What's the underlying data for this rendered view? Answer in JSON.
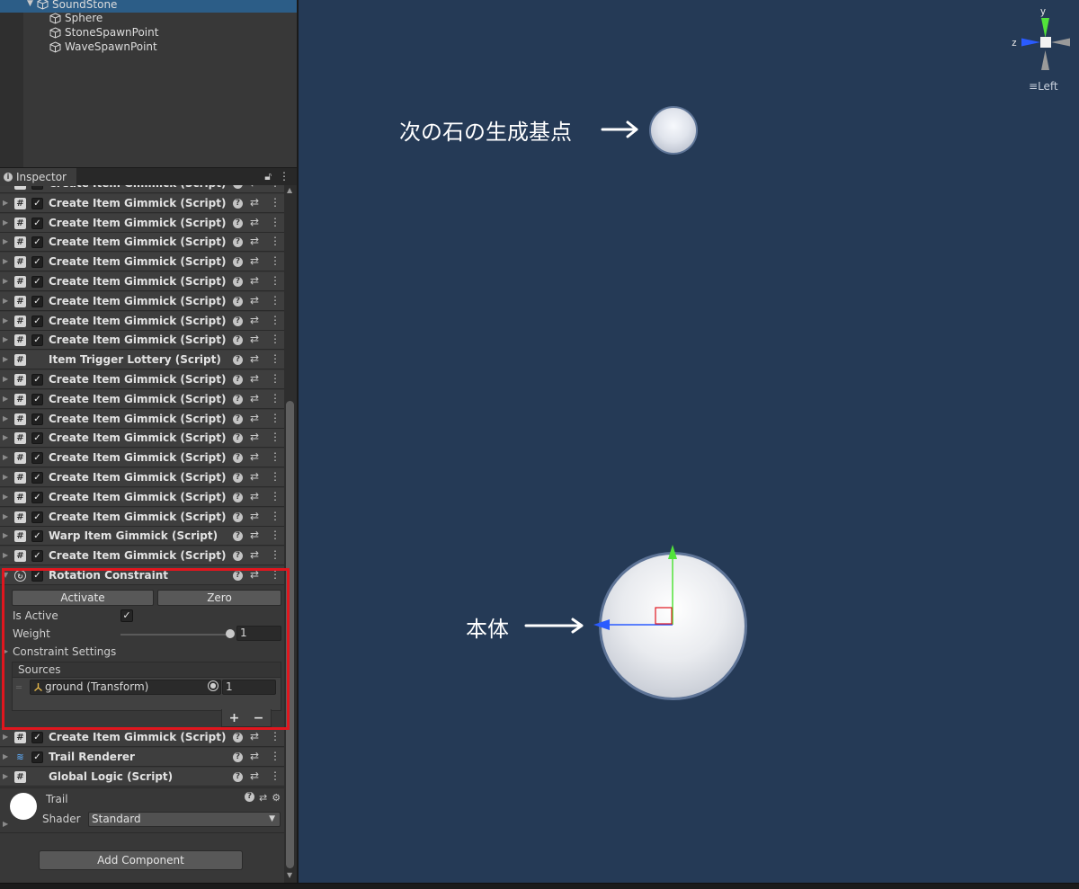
{
  "hierarchy": {
    "items": [
      {
        "label": "SoundStone",
        "selected": true,
        "expanded": true
      },
      {
        "label": "Sphere"
      },
      {
        "label": "StoneSpawnPoint"
      },
      {
        "label": "WaveSpawnPoint"
      }
    ]
  },
  "inspector": {
    "tab_label": "Inspector",
    "components": [
      {
        "name": "Create Item Gimmick (Script)",
        "icon": "script-icon",
        "enabled": true
      },
      {
        "name": "Create Item Gimmick (Script)",
        "icon": "script-icon",
        "enabled": true
      },
      {
        "name": "Create Item Gimmick (Script)",
        "icon": "script-icon",
        "enabled": true
      },
      {
        "name": "Create Item Gimmick (Script)",
        "icon": "script-icon",
        "enabled": true
      },
      {
        "name": "Create Item Gimmick (Script)",
        "icon": "script-icon",
        "enabled": true
      },
      {
        "name": "Create Item Gimmick (Script)",
        "icon": "script-icon",
        "enabled": true
      },
      {
        "name": "Create Item Gimmick (Script)",
        "icon": "script-icon",
        "enabled": true
      },
      {
        "name": "Create Item Gimmick (Script)",
        "icon": "script-icon",
        "enabled": true
      },
      {
        "name": "Create Item Gimmick (Script)",
        "icon": "script-icon",
        "enabled": true
      },
      {
        "name": "Item Trigger Lottery (Script)",
        "icon": "script-icon",
        "enabled": null
      },
      {
        "name": "Create Item Gimmick (Script)",
        "icon": "script-icon",
        "enabled": true
      },
      {
        "name": "Create Item Gimmick (Script)",
        "icon": "script-icon",
        "enabled": true
      },
      {
        "name": "Create Item Gimmick (Script)",
        "icon": "script-icon",
        "enabled": true
      },
      {
        "name": "Create Item Gimmick (Script)",
        "icon": "script-icon",
        "enabled": true
      },
      {
        "name": "Create Item Gimmick (Script)",
        "icon": "script-icon",
        "enabled": true
      },
      {
        "name": "Create Item Gimmick (Script)",
        "icon": "script-icon",
        "enabled": true
      },
      {
        "name": "Create Item Gimmick (Script)",
        "icon": "script-icon",
        "enabled": true
      },
      {
        "name": "Create Item Gimmick (Script)",
        "icon": "script-icon",
        "enabled": true
      },
      {
        "name": "Warp Item Gimmick (Script)",
        "icon": "script-icon",
        "enabled": true
      },
      {
        "name": "Create Item Gimmick (Script)",
        "icon": "script-icon",
        "enabled": true
      },
      {
        "name": "Rotation Constraint",
        "icon": "constraint-icon",
        "enabled": true,
        "expanded": true
      }
    ],
    "rotation_constraint": {
      "activate_label": "Activate",
      "zero_label": "Zero",
      "is_active_label": "Is Active",
      "is_active": true,
      "weight_label": "Weight",
      "weight_value": "1",
      "weight_fraction": 1.0,
      "constraint_settings_label": "Constraint Settings",
      "sources_label": "Sources",
      "sources": [
        {
          "object": "ground (Transform)",
          "weight": "1"
        }
      ],
      "plus": "+",
      "minus": "−"
    },
    "after_components": [
      {
        "name": "Create Item Gimmick (Script)",
        "icon": "script-icon",
        "enabled": true
      },
      {
        "name": "Trail Renderer",
        "icon": "trail-renderer-icon",
        "enabled": true
      },
      {
        "name": "Global Logic (Script)",
        "icon": "script-icon",
        "enabled": null
      }
    ],
    "material": {
      "name": "Trail",
      "shader_label": "Shader",
      "shader_value": "Standard"
    },
    "add_component_label": "Add Component"
  },
  "scene": {
    "next_stone_label": "次の石の生成基点",
    "body_label": "本体",
    "orientation": {
      "y": "y",
      "z": "z",
      "view_label": "Left"
    }
  },
  "colors": {
    "scene_bg": "#253a56",
    "selection": "#2c5d87",
    "highlight": "#e0161e",
    "axis_y": "#52e33a",
    "axis_z": "#2a5bff",
    "axis_x": "#e0161e"
  }
}
